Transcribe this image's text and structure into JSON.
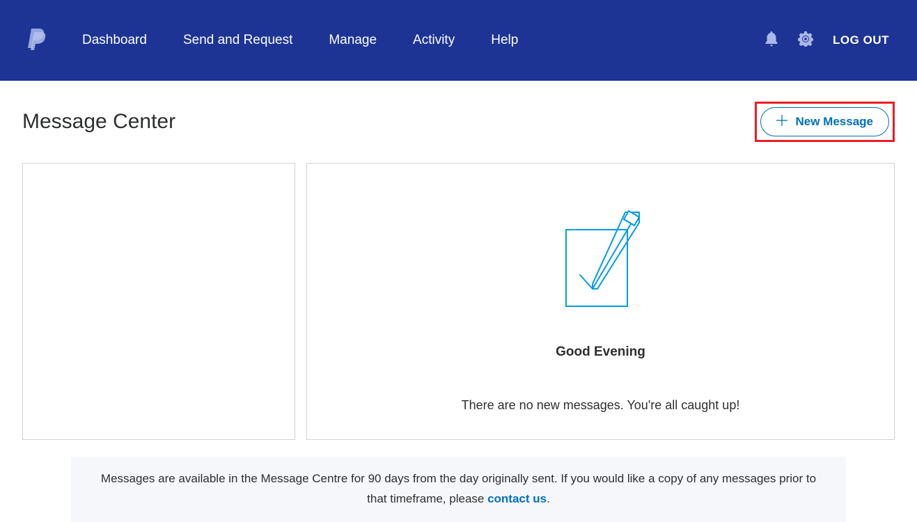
{
  "nav": {
    "items": [
      "Dashboard",
      "Send and Request",
      "Manage",
      "Activity",
      "Help"
    ],
    "logout": "LOG OUT"
  },
  "page": {
    "title": "Message Center",
    "newMessageLabel": "New Message"
  },
  "main": {
    "greeting": "Good Evening",
    "emptyState": "There are no new messages. You're all caught up!"
  },
  "footer": {
    "text1": "Messages are available in the Message Centre for 90 days from the day originally sent. If you would like a copy of any messages prior to that timeframe, please ",
    "contactLink": "contact us",
    "text2": "."
  }
}
